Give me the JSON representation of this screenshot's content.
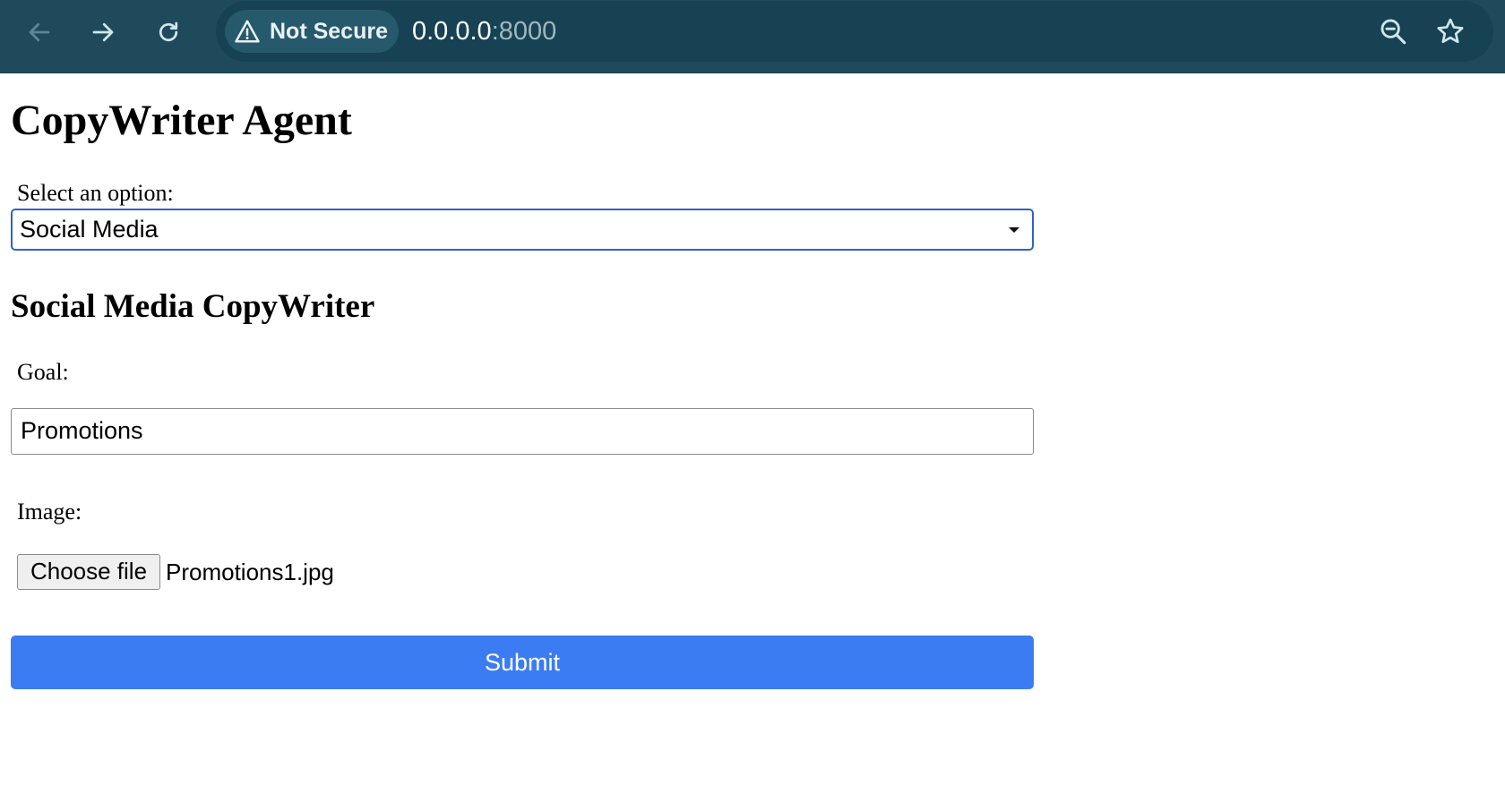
{
  "browser": {
    "security_label": "Not Secure",
    "url_host": "0.0.0.0",
    "url_port": ":8000",
    "icons": [
      "back-arrow-icon",
      "forward-arrow-icon",
      "reload-icon",
      "warning-icon",
      "zoom-out-icon",
      "star-icon"
    ]
  },
  "page": {
    "title": "CopyWriter Agent",
    "select_label": "Select an option:",
    "select_value": "Social Media",
    "section_title": "Social Media CopyWriter",
    "goal_label": "Goal:",
    "goal_value": "Promotions",
    "image_label": "Image:",
    "file_button": "Choose file",
    "file_name": "Promotions1.jpg",
    "submit_label": "Submit"
  },
  "colors": {
    "toolbar": "#1f4a5b",
    "submit": "#3b7cf2",
    "select_focus": "#2b63c9"
  }
}
